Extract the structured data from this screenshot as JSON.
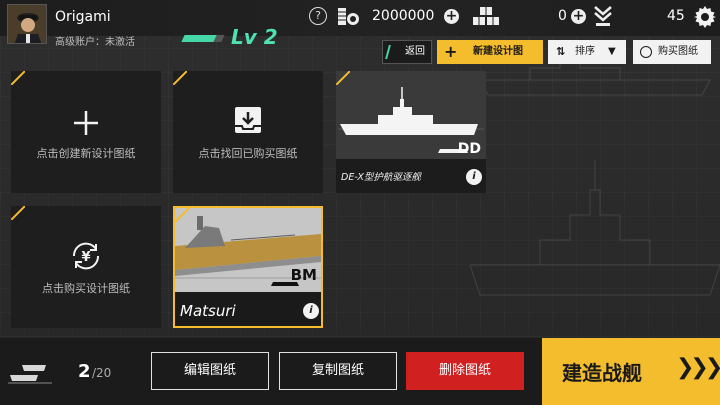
{
  "player": {
    "name": "Origami",
    "account_status": "高级账户：未激活",
    "level": "Lv 2",
    "level_progress": 0.8
  },
  "resources": {
    "help": "?",
    "coins": "2000000",
    "parts": "0",
    "rank": "45"
  },
  "actions": {
    "back": "返回",
    "new_design": "新建设计图",
    "sort": "排序",
    "buy_blueprint": "购买图纸"
  },
  "cards": {
    "create": "点击创建新设计图纸",
    "recover": "点击找回已购买图纸",
    "design1": {
      "name": "DE-X型护航驱逐舰",
      "class": "DD"
    },
    "purchase": "点击购买设计图纸",
    "design2": {
      "name": "Matsuri",
      "class": "BM"
    }
  },
  "bottom": {
    "count_current": "2",
    "count_max": "/20",
    "edit": "编辑图纸",
    "copy": "复制图纸",
    "delete": "删除图纸",
    "build": "建造战舰"
  },
  "colors": {
    "accent_yellow": "#f4bd2d",
    "accent_teal": "#45d7a8",
    "danger_red": "#d0201f"
  },
  "icons": {
    "avatar": "avatar-portrait",
    "help": "help-icon",
    "coins": "coin-stack-icon",
    "parts": "crates-icon",
    "rank": "rank-insignia-icon",
    "settings": "gear-icon",
    "add": "plus-icon",
    "sort": "sort-icon",
    "globe": "globe-icon",
    "download": "download-icon",
    "yen": "yen-cycle-icon",
    "info": "info-icon",
    "fleet": "fleet-icon",
    "chevrons": "chevron-right-icon"
  }
}
